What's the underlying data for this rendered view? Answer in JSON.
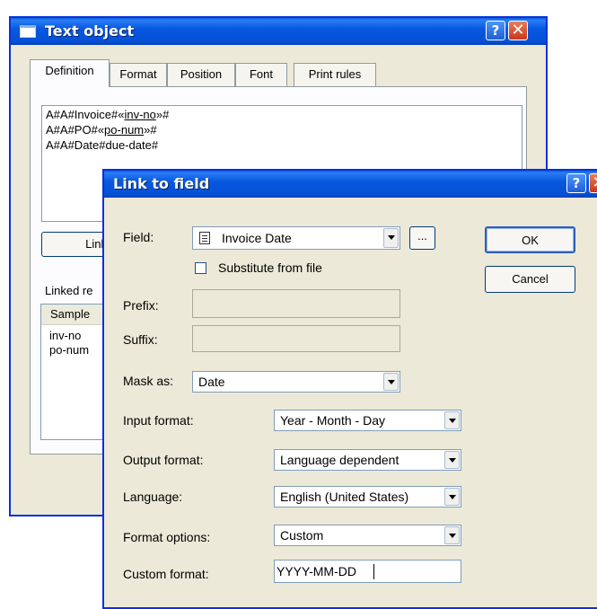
{
  "text_object": {
    "title": "Text object",
    "tabs": [
      "Definition",
      "Format",
      "Position",
      "Font",
      "Print rules"
    ],
    "definition_lines": [
      {
        "pre": "A#A#Invoice#«",
        "link": "inv-no",
        "post": "»#"
      },
      {
        "pre": "A#A#PO#«",
        "link": "po-num",
        "post": "»#"
      },
      {
        "pre": "A#A#Date#due-date#",
        "link": "",
        "post": ""
      }
    ],
    "link_button_label": "Link",
    "linked_label": "Linked re",
    "list_header": "Sample",
    "list_items": [
      "inv-no",
      "po-num"
    ]
  },
  "link_dialog": {
    "title": "Link to field",
    "field_label": "Field:",
    "field_value": "Invoice Date",
    "browse_label": "...",
    "substitute_label": "Substitute from file",
    "substitute_checked": false,
    "prefix_label": "Prefix:",
    "suffix_label": "Suffix:",
    "mask_label": "Mask as:",
    "mask_value": "Date",
    "input_format_label": "Input format:",
    "input_format_value": "Year - Month - Day",
    "output_format_label": "Output format:",
    "output_format_value": "Language dependent",
    "language_label": "Language:",
    "language_value": "English (United States)",
    "format_options_label": "Format options:",
    "format_options_value": "Custom",
    "custom_format_label": "Custom format:",
    "custom_format_value": "YYYY-MM-DD",
    "ok_label": "OK",
    "cancel_label": "Cancel"
  },
  "colors": {
    "title_bar": "#0858e0",
    "face": "#ece9d8",
    "help_button": "#1e5fd6",
    "close_button": "#c8381a"
  },
  "icons": {
    "window": "window-icon",
    "help": "help-icon",
    "close": "close-icon",
    "field": "document-icon"
  }
}
